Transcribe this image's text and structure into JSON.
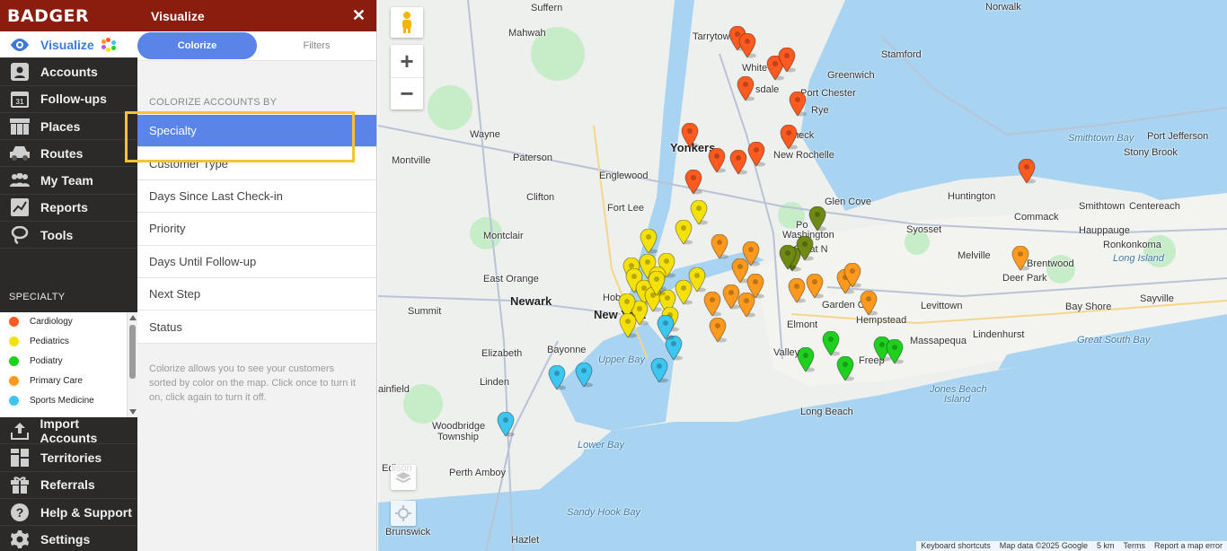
{
  "app": {
    "logo": "BADGER"
  },
  "nav": {
    "items_top": [
      {
        "id": "visualize",
        "label": "Visualize",
        "icon": "eye-icon",
        "active": true
      },
      {
        "id": "accounts",
        "label": "Accounts",
        "icon": "person-icon"
      },
      {
        "id": "followups",
        "label": "Follow-ups",
        "icon": "calendar-icon"
      },
      {
        "id": "places",
        "label": "Places",
        "icon": "building-icon"
      },
      {
        "id": "routes",
        "label": "Routes",
        "icon": "car-icon"
      },
      {
        "id": "myteam",
        "label": "My Team",
        "icon": "team-icon"
      },
      {
        "id": "reports",
        "label": "Reports",
        "icon": "chart-icon"
      },
      {
        "id": "tools",
        "label": "Tools",
        "icon": "lasso-icon"
      }
    ],
    "items_bottom": [
      {
        "id": "import",
        "label": "Import Accounts",
        "icon": "upload-icon"
      },
      {
        "id": "territories",
        "label": "Territories",
        "icon": "grid-icon"
      },
      {
        "id": "referrals",
        "label": "Referrals",
        "icon": "gift-icon"
      },
      {
        "id": "help",
        "label": "Help & Support",
        "icon": "question-icon"
      },
      {
        "id": "settings",
        "label": "Settings",
        "icon": "gear-icon"
      }
    ],
    "specialty_title": "SPECIALTY",
    "legend": [
      {
        "label": "Cardiology",
        "color": "#ff5a1f"
      },
      {
        "label": "Pediatrics",
        "color": "#f5e10a"
      },
      {
        "label": "Podiatry",
        "color": "#1fd11f"
      },
      {
        "label": "Primary Care",
        "color": "#ff9a1f"
      },
      {
        "label": "Sports Medicine",
        "color": "#3cc6f0"
      }
    ]
  },
  "panel": {
    "title": "Visualize",
    "close": "✕",
    "tabs": [
      "Colorize",
      "Filters"
    ],
    "section_title": "COLORIZE ACCOUNTS BY",
    "options": [
      "Specialty",
      "Customer Type",
      "Days Since Last Check-in",
      "Priority",
      "Days Until Follow-up",
      "Next Step",
      "Status"
    ],
    "selected": "Specialty",
    "hint": "Colorize allows you to see your customers sorted by color on the map. Click once to turn it on, click again to turn it off."
  },
  "map": {
    "zoom_in": "+",
    "zoom_out": "−",
    "labels": [
      {
        "t": "Suffern"
      },
      {
        "t": "Mahwah"
      },
      {
        "t": "Tarrytown"
      },
      {
        "t": "White"
      },
      {
        "t": "sdale"
      },
      {
        "t": "Greenwich"
      },
      {
        "t": "Stamford"
      },
      {
        "t": "Norwalk"
      },
      {
        "t": "Port Chester"
      },
      {
        "t": "Rye"
      },
      {
        "t": "Mam"
      },
      {
        "t": "neck"
      },
      {
        "t": "Yonkers"
      },
      {
        "t": "New Rochelle"
      },
      {
        "t": "Wayne"
      },
      {
        "t": "Paterson"
      },
      {
        "t": "Montville"
      },
      {
        "t": "Englewood"
      },
      {
        "t": "Clifton"
      },
      {
        "t": "Fort Lee"
      },
      {
        "t": "Montclair"
      },
      {
        "t": "East Orange"
      },
      {
        "t": "Hobok"
      },
      {
        "t": "Newark"
      },
      {
        "t": "New York"
      },
      {
        "t": "Summit"
      },
      {
        "t": "Bayonne"
      },
      {
        "t": "Elizabeth"
      },
      {
        "t": "Linden"
      },
      {
        "t": "ainfield"
      },
      {
        "t": "Woodbridge"
      },
      {
        "t": "Township"
      },
      {
        "t": "Edison"
      },
      {
        "t": "Perth Amboy"
      },
      {
        "t": "Brunswick"
      },
      {
        "t": "Hazlet"
      },
      {
        "t": "Sandy Hook Bay"
      },
      {
        "t": "Lower Bay"
      },
      {
        "t": "Upper Bay"
      },
      {
        "t": "Long Beach"
      },
      {
        "t": "Jones Beach"
      },
      {
        "t": "Island"
      },
      {
        "t": "Valley"
      },
      {
        "t": "Freep"
      },
      {
        "t": "Elmont"
      },
      {
        "t": "Garden C"
      },
      {
        "t": "Hempstead"
      },
      {
        "t": "Levittown"
      },
      {
        "t": "Massapequa"
      },
      {
        "t": "Lindenhurst"
      },
      {
        "t": "Glen Cove"
      },
      {
        "t": "Po"
      },
      {
        "t": "Washington"
      },
      {
        "t": "Great N"
      },
      {
        "t": "Syosset"
      },
      {
        "t": "Huntington"
      },
      {
        "t": "Commack"
      },
      {
        "t": "Melville"
      },
      {
        "t": "Deer Park"
      },
      {
        "t": "Brentwood"
      },
      {
        "t": "Smithtown"
      },
      {
        "t": "Hauppauge"
      },
      {
        "t": "Ronkonkoma"
      },
      {
        "t": "Long Island"
      },
      {
        "t": "Centereach"
      },
      {
        "t": "Stony Brook"
      },
      {
        "t": "Port Jefferson"
      },
      {
        "t": "Smithtown Bay"
      },
      {
        "t": "Bay Shore"
      },
      {
        "t": "Sayville"
      },
      {
        "t": "Great South Bay"
      }
    ],
    "attribution": [
      "Keyboard shortcuts",
      "Map data ©2025 Google",
      "5 km",
      "Terms",
      "Report a map error"
    ]
  }
}
